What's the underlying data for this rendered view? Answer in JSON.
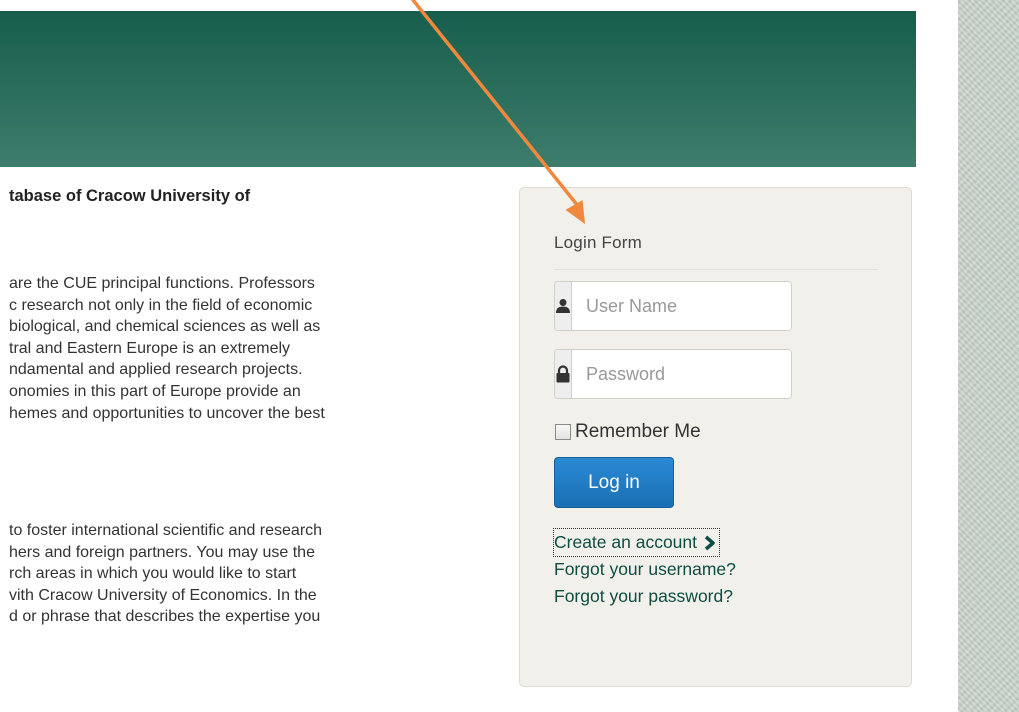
{
  "article": {
    "heading": "tabase of Cracow University of",
    "paragraph1": [
      "are the CUE principal functions. Professors",
      "c research not only in the field of economic",
      "biological, and chemical sciences as well as",
      "tral and Eastern Europe is an extremely",
      "ndamental and applied research projects.",
      "onomies in this part of Europe provide an",
      "hemes and opportunities to uncover the best"
    ],
    "paragraph2": [
      "to foster international scientific and research",
      "hers and foreign partners. You may use the",
      "rch areas in which you would like to start",
      "vith Cracow University of Economics. In the",
      "d or phrase that describes the expertise you"
    ]
  },
  "login": {
    "title": "Login Form",
    "username_placeholder": "User Name",
    "password_placeholder": "Password",
    "remember_label": "Remember Me",
    "login_button": "Log in",
    "create_account": "Create an account",
    "forgot_username": "Forgot your username?",
    "forgot_password": "Forgot your password?"
  },
  "colors": {
    "header": "#175e4c",
    "link": "#0e4d43",
    "button": "#2a8ad4",
    "annotation_arrow": "#f0883e"
  },
  "icons": {
    "username": "user-icon",
    "password": "lock-icon",
    "create_account": "chevron-right-icon"
  }
}
